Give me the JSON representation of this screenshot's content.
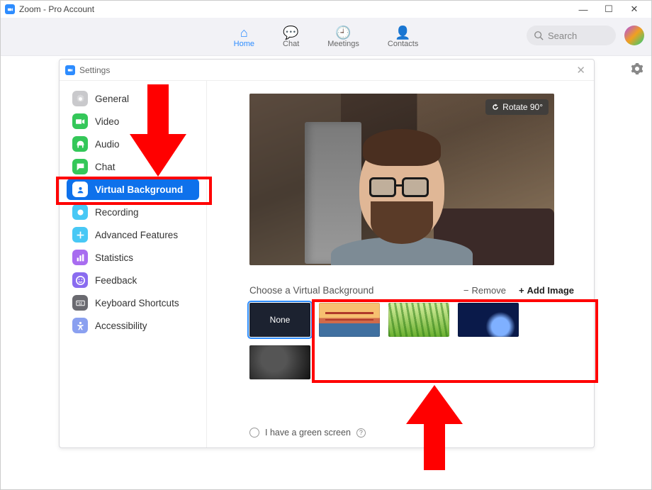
{
  "window": {
    "title": "Zoom - Pro Account"
  },
  "nav": {
    "home": "Home",
    "chat": "Chat",
    "meetings": "Meetings",
    "contacts": "Contacts"
  },
  "search": {
    "placeholder": "Search"
  },
  "settings": {
    "title": "Settings",
    "sidebar": [
      {
        "label": "General",
        "color": "#c9c9cc"
      },
      {
        "label": "Video",
        "color": "#34c759"
      },
      {
        "label": "Audio",
        "color": "#34c759"
      },
      {
        "label": "Chat",
        "color": "#34c759"
      },
      {
        "label": "Virtual Background",
        "color": "#0E71EB"
      },
      {
        "label": "Recording",
        "color": "#48c8f5"
      },
      {
        "label": "Advanced Features",
        "color": "#48c8f5"
      },
      {
        "label": "Statistics",
        "color": "#a86cf0"
      },
      {
        "label": "Feedback",
        "color": "#8a6cf0"
      },
      {
        "label": "Keyboard Shortcuts",
        "color": "#6a6a70"
      },
      {
        "label": "Accessibility",
        "color": "#8aa0f0"
      }
    ],
    "rotate_label": "Rotate 90°",
    "choose_label": "Choose a Virtual Background",
    "remove_label": "Remove",
    "add_label": "Add Image",
    "none_label": "None",
    "greenscreen_label": "I have a green screen"
  }
}
